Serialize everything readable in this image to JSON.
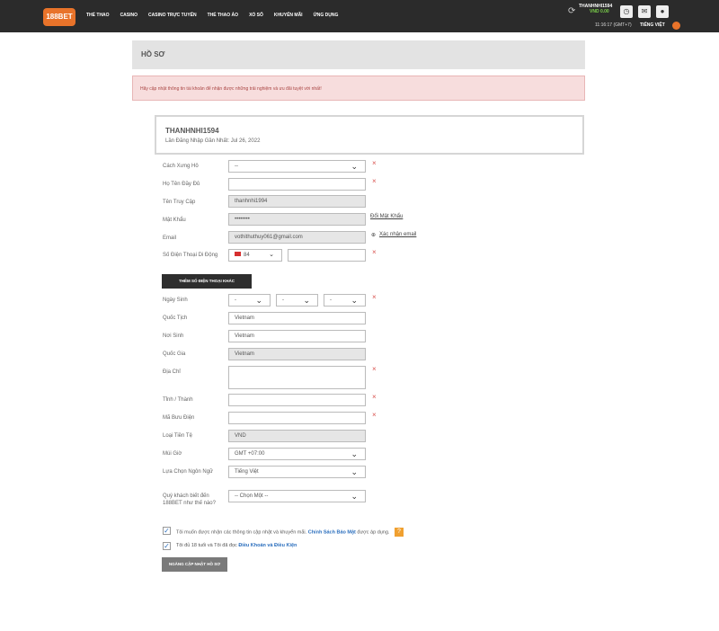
{
  "topbar": {
    "logo": "188BET",
    "nav": [
      "THỂ THAO",
      "CASINO",
      "CASINO TRỰC TUYẾN",
      "THỂ THAO ẢO",
      "XỔ SỐ",
      "KHUYẾN MÃI",
      "ỨNG DỤNG"
    ],
    "username": "THANHNHI1594",
    "balance": "VND 0.00",
    "refresh_icon": "refresh-icon",
    "time": "11:16:17 (GMT+7)",
    "language": "TIẾNG VIỆT",
    "icons": [
      "clock-icon",
      "mail-icon",
      "account-icon"
    ]
  },
  "page": {
    "title": "HỒ SƠ",
    "alert": "Hãy cập nhật thông tin tài khoản để nhận được những trải nghiệm và ưu đãi tuyệt vời nhất!"
  },
  "profile_card": {
    "username": "THANHNHI1594",
    "last_login": "Lần Đăng Nhập Gần Nhất: Jul 26, 2022"
  },
  "form": {
    "salutation_label": "Cách Xưng Hô",
    "salutation_value": "--",
    "fullname_label": "Họ Tên Đầy Đủ",
    "fullname_value": "",
    "login_label": "Tên Truy Cập",
    "login_value": "thanhnhi1994",
    "password_label": "Mật Khẩu",
    "password_value": "••••••••",
    "change_password": "Đổi Mật Khẩu",
    "email_label": "Email",
    "email_value": "vothithuthuy061@gmail.com",
    "verify_email": "Xác nhận email",
    "phone_label": "Số Điện Thoại Di Động",
    "phone_code": "84",
    "phone_value": "",
    "add_phone": "THÊM SỐ ĐIỆN THOẠI KHÁC",
    "dob_label": "Ngày Sinh",
    "dob_day": "-",
    "dob_month": "-",
    "dob_year": "-",
    "nationality_label": "Quốc Tịch",
    "nationality_value": "Vietnam",
    "birthplace_label": "Nơi Sinh",
    "birthplace_value": "Vietnam",
    "country_label": "Quốc Gia",
    "country_value": "Vietnam",
    "address_label": "Địa Chỉ",
    "address_value": "",
    "city_label": "Tỉnh / Thành",
    "city_value": "",
    "postal_label": "Mã Bưu Điện",
    "postal_value": "",
    "currency_label": "Loại Tiền Tệ",
    "currency_value": "VND",
    "timezone_label": "Múi Giờ",
    "timezone_value": "GMT +07:00",
    "language_label": "Lựa Chọn Ngôn Ngữ",
    "language_value": "Tiếng Việt",
    "referral_label": "Quý khách biết đến 188BET như thế nào?",
    "referral_value": "-- Chọn Một --"
  },
  "consent": {
    "marketing_text": "Tôi muốn được nhận các thông tin cập nhật và khuyến mãi.",
    "privacy_link": "Chính Sách Bảo Mật",
    "marketing_suffix": "được áp dụng.",
    "help_icon": "?",
    "age_text": "Tôi đủ 18 tuổi và Tôi đã đọc",
    "terms_link": "Điều Khoản và Điều Kiện"
  },
  "submit_label": "NGĂNG CẬP NHẬT HỒ SƠ",
  "colors": {
    "brand": "#e8732a",
    "topbar": "#2b2b2b",
    "link": "#2a6ebd",
    "error": "#d9534f"
  }
}
